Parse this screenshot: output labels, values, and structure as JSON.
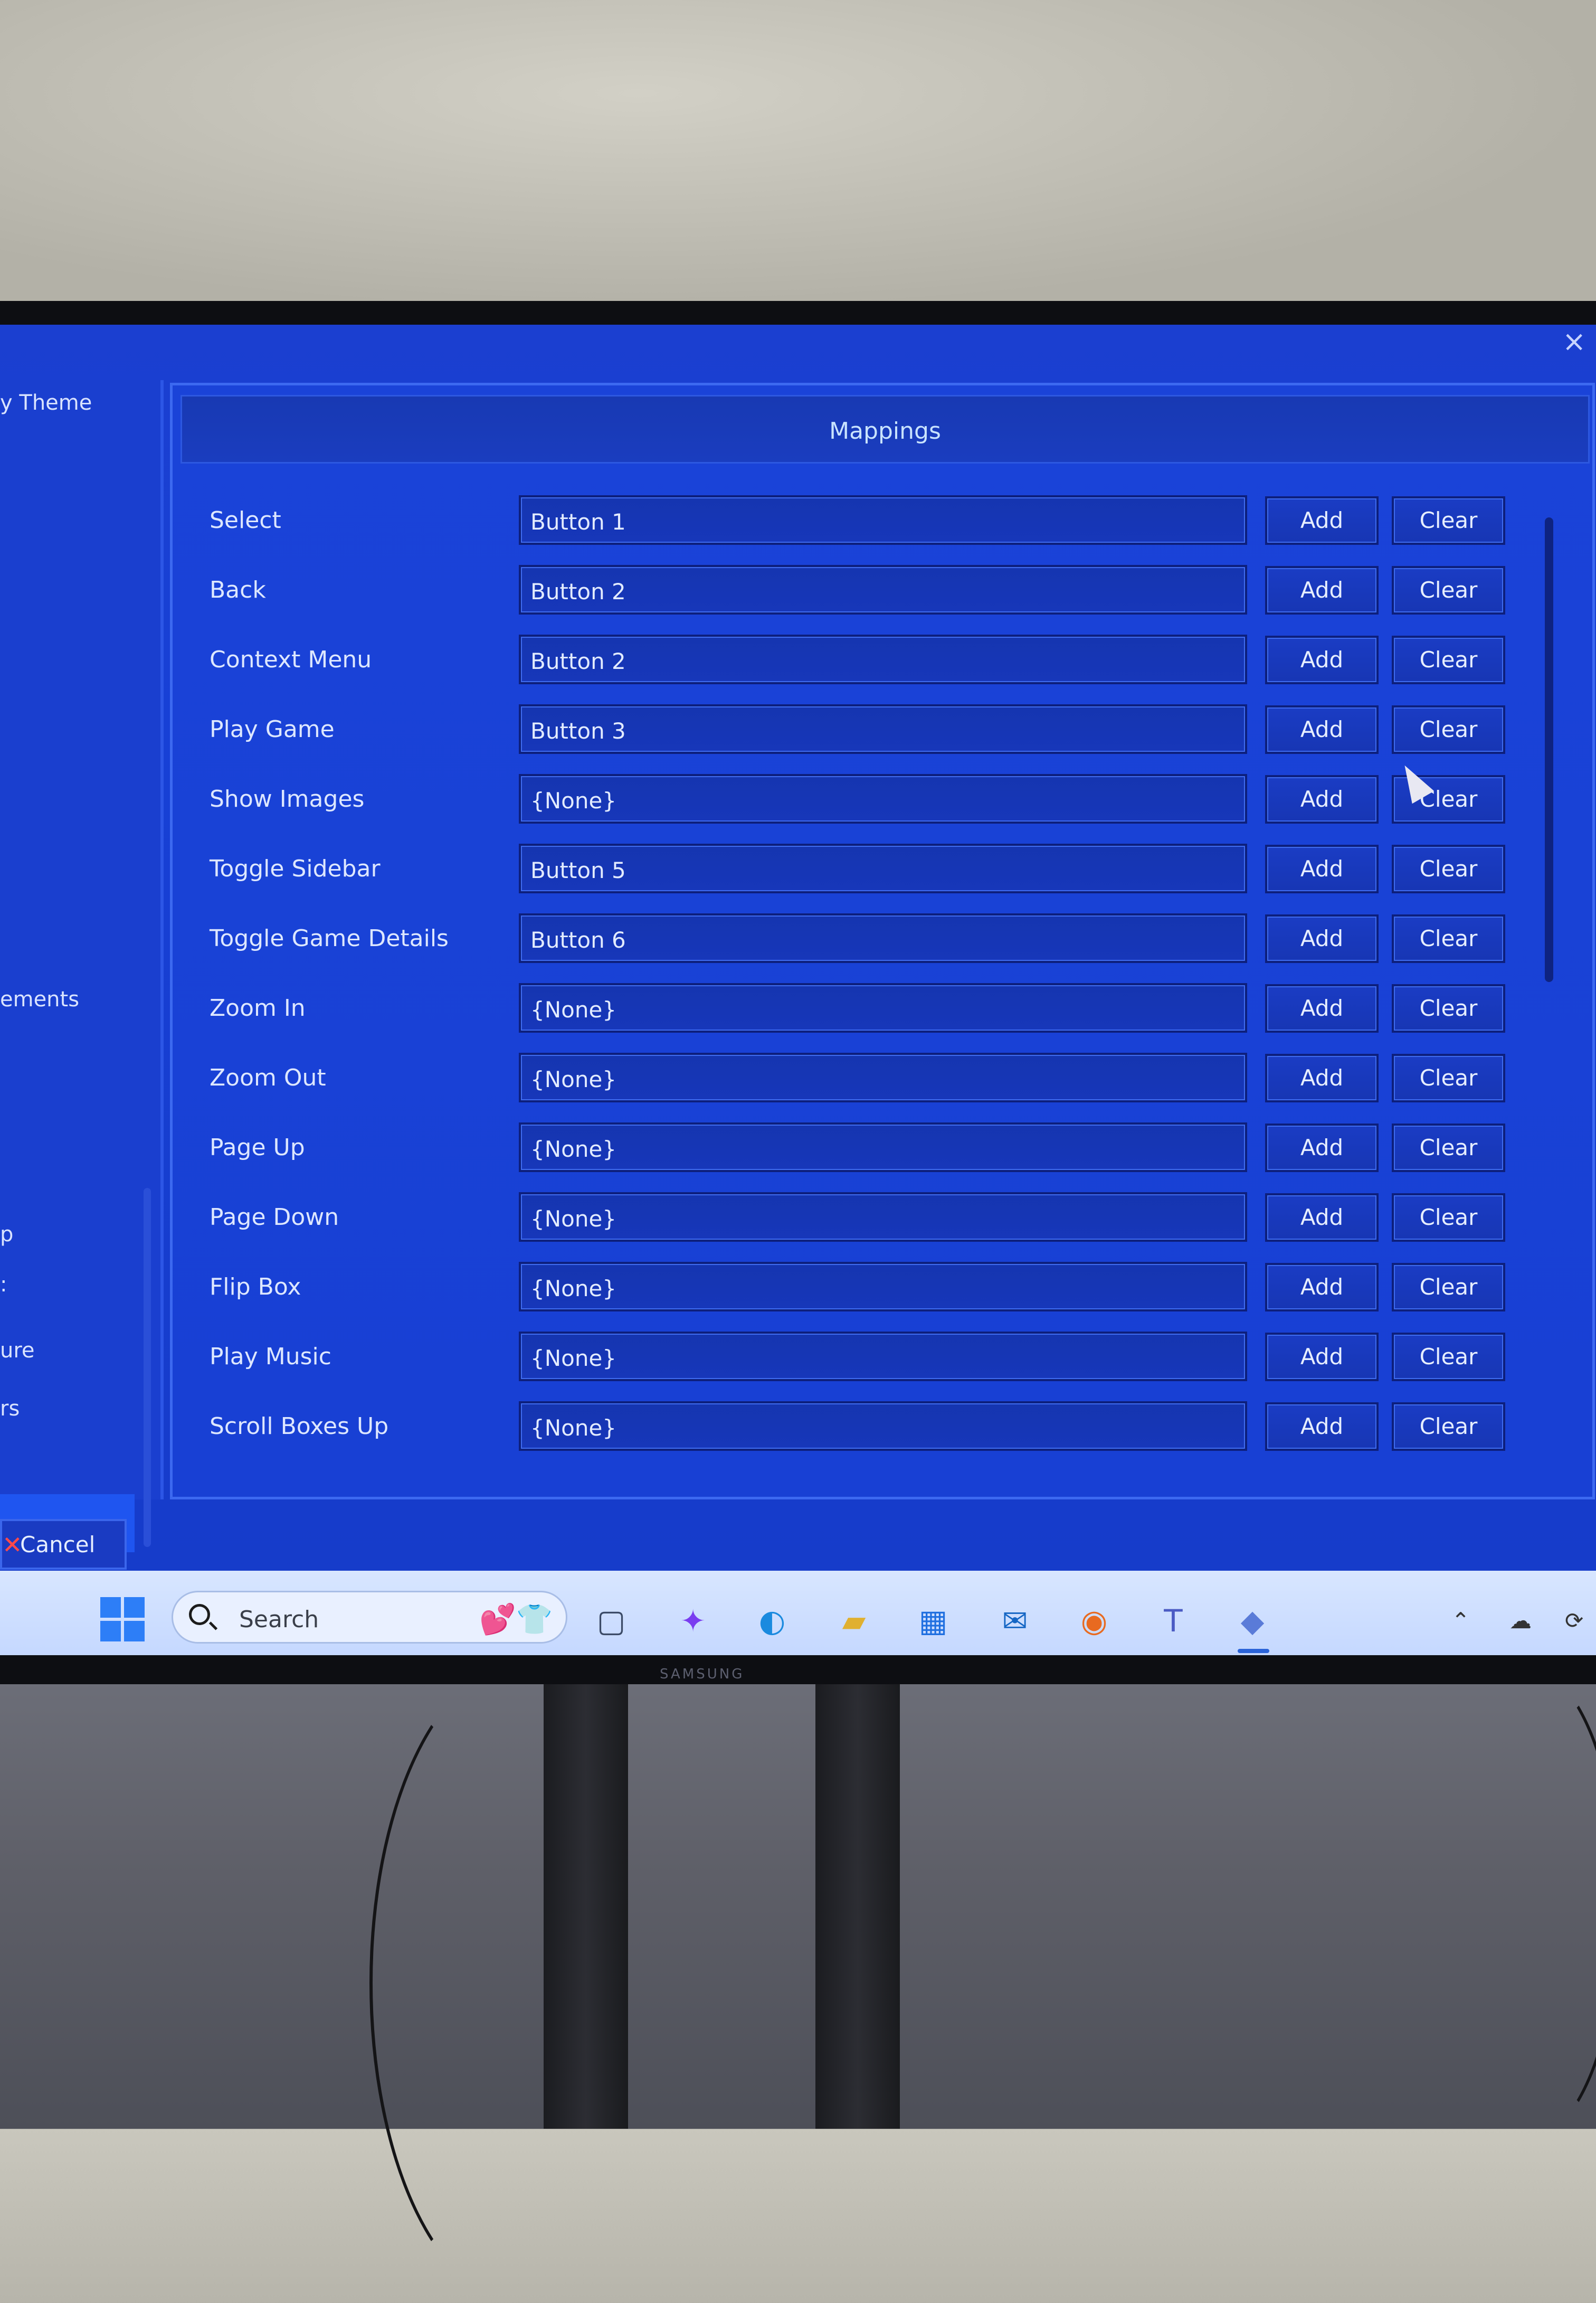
{
  "dialog": {
    "title": "Mappings",
    "close_icon": "close-icon"
  },
  "sidebar": {
    "items": [
      {
        "label": "y Theme"
      },
      {
        "label": "ements"
      },
      {
        "label": "p"
      },
      {
        "label": ":"
      },
      {
        "label": "ure"
      },
      {
        "label": "rs"
      }
    ]
  },
  "buttons": {
    "add_label": "Add",
    "clear_label": "Clear",
    "cancel_label": "Cancel"
  },
  "mappings": [
    {
      "action": "Select",
      "value": "Button 1"
    },
    {
      "action": "Back",
      "value": "Button 2"
    },
    {
      "action": "Context Menu",
      "value": "Button 2"
    },
    {
      "action": "Play Game",
      "value": "Button 3"
    },
    {
      "action": "Show Images",
      "value": "{None}"
    },
    {
      "action": "Toggle Sidebar",
      "value": "Button 5"
    },
    {
      "action": "Toggle Game Details",
      "value": "Button 6"
    },
    {
      "action": "Zoom In",
      "value": "{None}"
    },
    {
      "action": "Zoom Out",
      "value": "{None}"
    },
    {
      "action": "Page Up",
      "value": "{None}"
    },
    {
      "action": "Page Down",
      "value": "{None}"
    },
    {
      "action": "Flip Box",
      "value": "{None}"
    },
    {
      "action": "Play Music",
      "value": "{None}"
    },
    {
      "action": "Scroll Boxes Up",
      "value": "{None}"
    }
  ],
  "taskbar": {
    "search_placeholder": "Search",
    "monitor_brand": "SAMSUNG",
    "icons": [
      "windows-start-icon",
      "search-icon",
      "task-view-icon",
      "copilot-icon",
      "edge-icon",
      "file-explorer-icon",
      "store-icon",
      "outlook-icon",
      "firefox-icon",
      "teams-icon",
      "app-icon"
    ]
  },
  "colors": {
    "screen_bg": "#1740d6",
    "panel_border": "#3c69f0",
    "text": "#dde7ff",
    "title_text": "#c9e3ff",
    "taskbar_bg": "#d8e6ff"
  }
}
